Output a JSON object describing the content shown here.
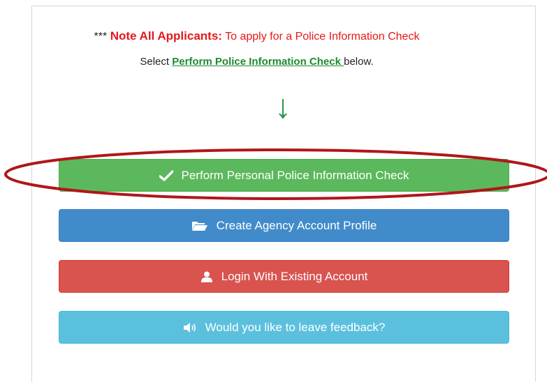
{
  "note": {
    "stars": "***",
    "strong": "Note All Applicants:",
    "text": "To apply for a Police Information Check"
  },
  "select_line": {
    "prefix": "Select",
    "link": "Perform Police Information Check ",
    "suffix": "below."
  },
  "arrow": {
    "glyph": "↓",
    "icon": "down-arrow-icon",
    "color": "#2c9444"
  },
  "buttons": [
    {
      "label": "Perform Personal Police Information Check",
      "icon": "checkmark-icon",
      "color": "#5cb85c"
    },
    {
      "label": "Create Agency Account Profile",
      "icon": "folder-open-icon",
      "color": "#428bca"
    },
    {
      "label": "Login With Existing Account",
      "icon": "user-icon",
      "color": "#d9534f"
    },
    {
      "label": "Would you like to leave feedback?",
      "icon": "speaker-icon",
      "color": "#5bc0de"
    }
  ],
  "annotation": {
    "type": "red-oval-highlight",
    "color": "#b0161a"
  }
}
